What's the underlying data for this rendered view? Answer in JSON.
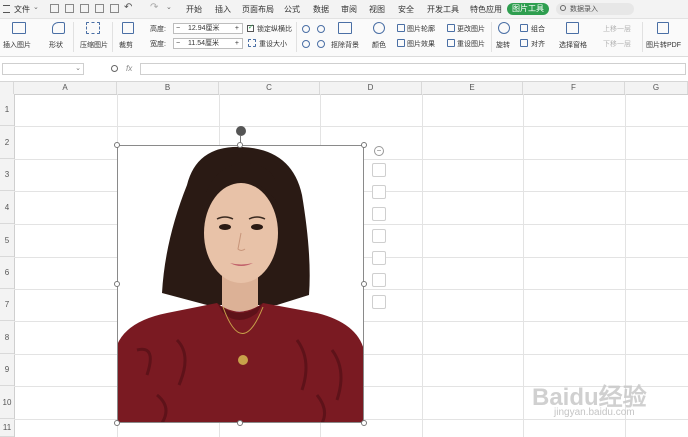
{
  "menubar": {
    "file_label": "文件",
    "tabs": [
      "开始",
      "插入",
      "页面布局",
      "公式",
      "数据",
      "审阅",
      "视图",
      "安全",
      "开发工具",
      "特色应用"
    ],
    "active_tab": "图片工具",
    "search_placeholder": "数据录入"
  },
  "ribbon": {
    "insert_picture": "插入图片",
    "shape": "形状",
    "compress": "压缩图片",
    "crop": "裁剪",
    "height_label": "高度:",
    "height_value": "12.94厘米",
    "width_label": "宽度:",
    "width_value": "11.54厘米",
    "lock_ratio": "锁定纵横比",
    "reset_size": "重设大小",
    "remove_bg": "抠除背景",
    "color": "颜色",
    "picture_outline": "图片轮廓",
    "picture_effect": "图片效果",
    "change_picture": "更改图片",
    "reset_picture": "重设图片",
    "rotate": "旋转",
    "group": "组合",
    "align": "对齐",
    "selection_pane": "选择窗格",
    "bring_forward": "上移一层",
    "send_backward": "下移一层",
    "picture_to_pdf": "图片转PDF"
  },
  "formula_bar": {
    "fx": "fx"
  },
  "grid": {
    "columns": [
      "A",
      "B",
      "C",
      "D",
      "E",
      "F",
      "G"
    ],
    "rows": [
      "1",
      "2",
      "3",
      "4",
      "5",
      "6",
      "7",
      "8",
      "9",
      "10",
      "11"
    ]
  },
  "watermark": {
    "brand": "Baidu经验",
    "url": "jingyan.baidu.com"
  },
  "colors": {
    "accent": "#2e9e4f",
    "sweater": "#7a1a22",
    "hair": "#2a1a14",
    "skin": "#e8c2a8"
  }
}
